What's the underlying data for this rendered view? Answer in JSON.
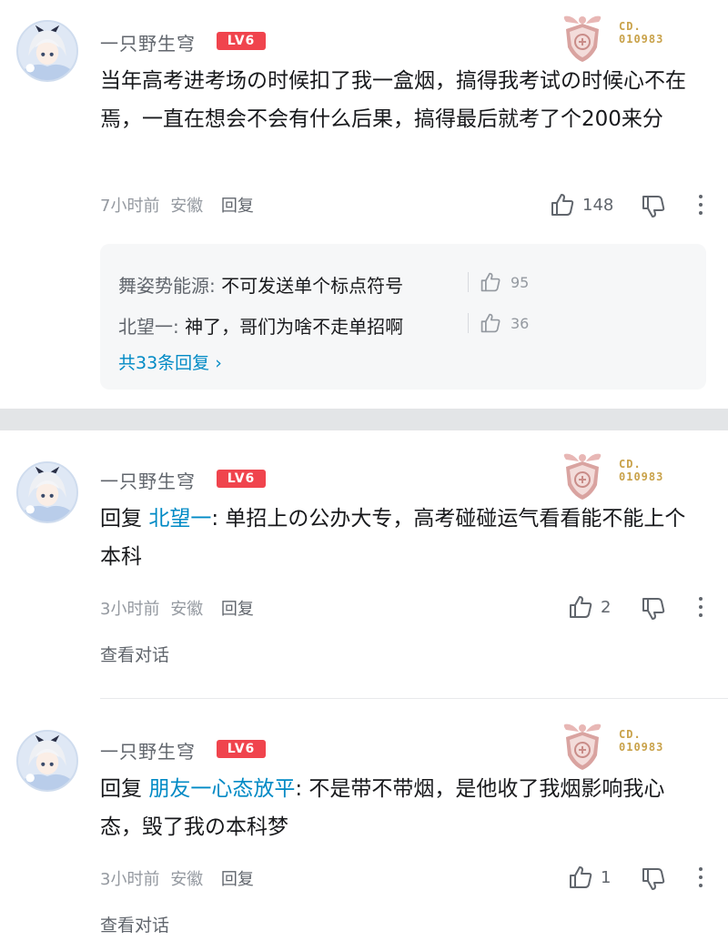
{
  "colors": {
    "level_badge": "#f0444d",
    "link": "#008ac5",
    "secondary_text": "#9499a0",
    "badge_gold": "#c9a24a"
  },
  "comments": [
    {
      "username": "一只野生穹",
      "level": "LV6",
      "badge_icon": "fan-medal-icon",
      "badge_label_1": "CD.",
      "badge_label_2": "010983",
      "text": "当年高考进考场の时候扣了我一盒烟，搞得我考试の时候心不在焉，一直在想会不会有什么后果，搞得最后就考了个200来分",
      "time": "7小时前",
      "location": "安徽",
      "reply_label": "回复",
      "likes": "148",
      "sub_replies": [
        {
          "name": "舞姿势能源:",
          "text": "不可发送单个标点符号",
          "likes": "95"
        },
        {
          "name": "北望一:",
          "text": "神了，哥们为啥不走单招啊",
          "likes": "36"
        }
      ],
      "total_replies": "共33条回复 ›"
    },
    {
      "username": "一只野生穹",
      "level": "LV6",
      "badge_label_1": "CD.",
      "badge_label_2": "010983",
      "reply_prefix": "回复",
      "mention": "北望一",
      "text": ": 单招上の公办大专，高考碰碰运气看看能不能上个本科",
      "time": "3小时前",
      "location": "安徽",
      "reply_label": "回复",
      "likes": "2",
      "view_conversation": "查看对话"
    },
    {
      "username": "一只野生穹",
      "level": "LV6",
      "badge_label_1": "CD.",
      "badge_label_2": "010983",
      "reply_prefix": "回复",
      "mention": "朋友一心态放平",
      "text": ": 不是带不带烟，是他收了我烟影响我心态，毁了我の本科梦",
      "time": "3小时前",
      "location": "安徽",
      "reply_label": "回复",
      "likes": "1",
      "view_conversation": "查看对话"
    }
  ]
}
